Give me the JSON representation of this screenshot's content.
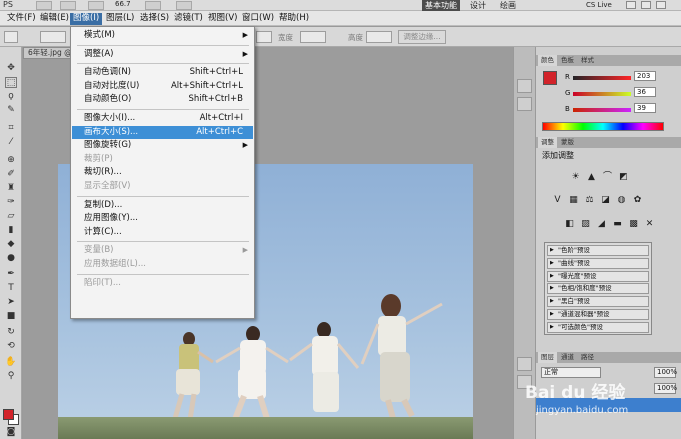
{
  "app": {
    "logo": "PS",
    "zoom": "66.7",
    "workspace_active": "基本功能",
    "workspace_items": [
      "设计",
      "绘画"
    ],
    "cs_live": "CS Live"
  },
  "menubar": [
    "文件(F)",
    "编辑(E)",
    "图像(I)",
    "图层(L)",
    "选择(S)",
    "滤镜(T)",
    "视图(V)",
    "窗口(W)",
    "帮助(H)"
  ],
  "optbar": {
    "feather_label": "宽度",
    "height_label": "高度",
    "refine_edge": "调整边缘..."
  },
  "document": {
    "tab": "6年轻.jpg @"
  },
  "image_menu": [
    {
      "label": "模式(M)",
      "submenu": true
    },
    {
      "sep": true
    },
    {
      "label": "调整(A)",
      "submenu": true
    },
    {
      "sep": true
    },
    {
      "label": "自动色调(N)",
      "shortcut": "Shift+Ctrl+L"
    },
    {
      "label": "自动对比度(U)",
      "shortcut": "Alt+Shift+Ctrl+L"
    },
    {
      "label": "自动颜色(O)",
      "shortcut": "Shift+Ctrl+B"
    },
    {
      "sep": true
    },
    {
      "label": "图像大小(I)...",
      "shortcut": "Alt+Ctrl+I"
    },
    {
      "label": "画布大小(S)...",
      "shortcut": "Alt+Ctrl+C",
      "highlighted": true
    },
    {
      "label": "图像旋转(G)",
      "submenu": true
    },
    {
      "label": "裁剪(P)",
      "disabled": true
    },
    {
      "label": "裁切(R)..."
    },
    {
      "label": "显示全部(V)",
      "disabled": true
    },
    {
      "sep": true
    },
    {
      "label": "复制(D)..."
    },
    {
      "label": "应用图像(Y)..."
    },
    {
      "label": "计算(C)..."
    },
    {
      "sep": true
    },
    {
      "label": "变量(B)",
      "submenu": true,
      "disabled": true
    },
    {
      "label": "应用数据组(L)...",
      "disabled": true
    },
    {
      "sep": true
    },
    {
      "label": "陷印(T)...",
      "disabled": true
    }
  ],
  "color_panel": {
    "tabs": [
      "颜色",
      "色板",
      "样式"
    ],
    "r": "203",
    "g": "36",
    "b": "39",
    "labels": [
      "R",
      "G",
      "B"
    ]
  },
  "adjust_panel": {
    "tabs": [
      "调整",
      "蒙版"
    ],
    "title": "添加调整",
    "presets": [
      "\"色阶\"预设",
      "\"曲线\"预设",
      "\"曝光度\"预设",
      "\"色相/饱和度\"预设",
      "\"黑白\"预设",
      "\"通道混和器\"预设",
      "\"可选颜色\"预设"
    ]
  },
  "layers_panel": {
    "tabs": [
      "图层",
      "通道",
      "路径"
    ],
    "mode": "正常",
    "opacity": "100%",
    "fill": "100%"
  },
  "watermark": {
    "text": "Bai du 经验",
    "url": "jingyan.baidu.com"
  },
  "colors": {
    "foreground": "#d2232a",
    "highlight": "#3d8fd6"
  }
}
